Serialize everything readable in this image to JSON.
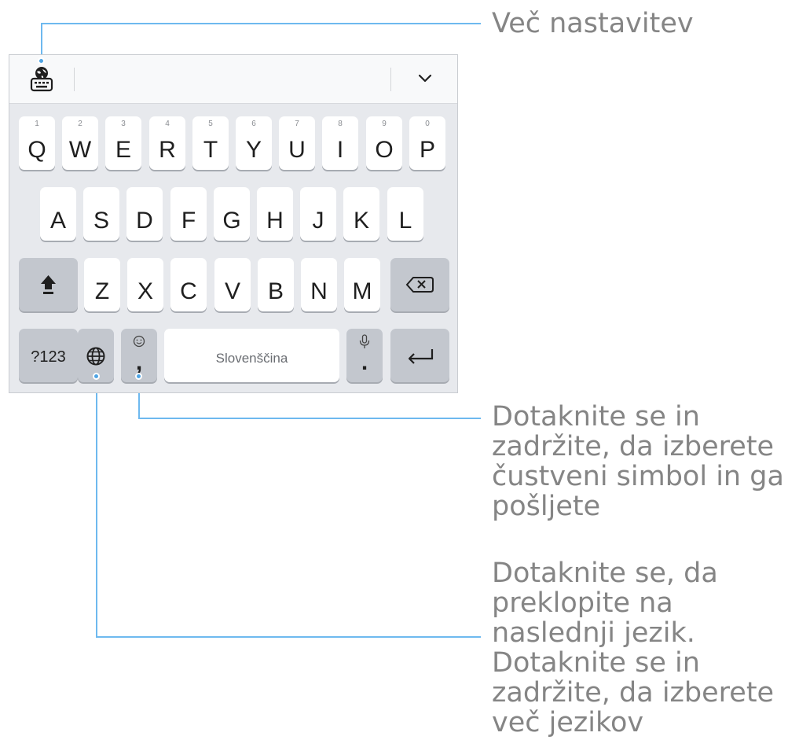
{
  "keyboard": {
    "rows": [
      [
        {
          "letter": "Q",
          "num": "1"
        },
        {
          "letter": "W",
          "num": "2"
        },
        {
          "letter": "E",
          "num": "3"
        },
        {
          "letter": "R",
          "num": "4"
        },
        {
          "letter": "T",
          "num": "5"
        },
        {
          "letter": "Y",
          "num": "6"
        },
        {
          "letter": "U",
          "num": "7"
        },
        {
          "letter": "I",
          "num": "8"
        },
        {
          "letter": "O",
          "num": "9"
        },
        {
          "letter": "P",
          "num": "0"
        }
      ],
      [
        {
          "letter": "A"
        },
        {
          "letter": "S"
        },
        {
          "letter": "D"
        },
        {
          "letter": "F"
        },
        {
          "letter": "G"
        },
        {
          "letter": "H"
        },
        {
          "letter": "J"
        },
        {
          "letter": "K"
        },
        {
          "letter": "L"
        }
      ],
      [
        {
          "letter": "Z"
        },
        {
          "letter": "X"
        },
        {
          "letter": "C"
        },
        {
          "letter": "V"
        },
        {
          "letter": "B"
        },
        {
          "letter": "N"
        },
        {
          "letter": "M"
        }
      ]
    ],
    "symbols_label": "?123",
    "comma_key": ",",
    "period_key": ".",
    "space_label": "Slovenščina"
  },
  "callouts": {
    "more_settings": "Več nastavitev",
    "emoji_lines": [
      "Dotaknite se in",
      "zadržite, da izberete",
      "čustveni simbol in ga",
      "pošljete"
    ],
    "language_lines": [
      "Dotaknite se, da",
      "preklopite na",
      "naslednji jezik.",
      "Dotaknite se in",
      "zadržite, da izberete",
      "več jezikov"
    ]
  },
  "colors": {
    "accent_line": "#6eb9ef",
    "keyboard_bg": "#e7e9ed",
    "callout_text": "#858585"
  }
}
